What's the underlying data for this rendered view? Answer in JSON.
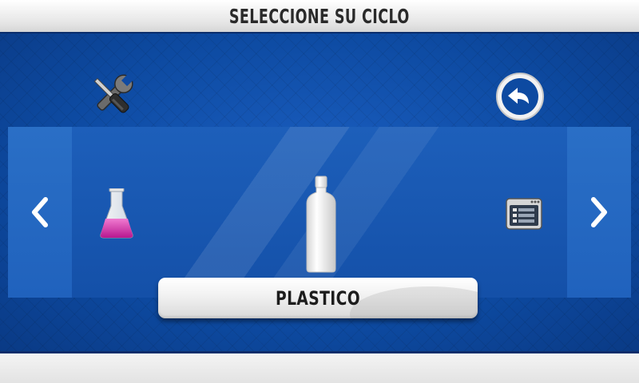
{
  "header": {
    "title": "SELECCIONE SU CICLO"
  },
  "toolbar": {
    "settings_icon": "tools-icon",
    "back_icon": "back-arrow-icon"
  },
  "carousel": {
    "prev_icon": "chevron-left-icon",
    "next_icon": "chevron-right-icon",
    "items": [
      {
        "icon": "flask-icon",
        "position": "left"
      },
      {
        "icon": "bottle-icon",
        "position": "center",
        "selected": true
      },
      {
        "icon": "oven-program-icon",
        "position": "right"
      }
    ]
  },
  "selection": {
    "label": "PLASTICO"
  },
  "colors": {
    "background": "#0e4aa3",
    "panel": "#1d5fba",
    "flask_liquid": "#e040b0"
  }
}
